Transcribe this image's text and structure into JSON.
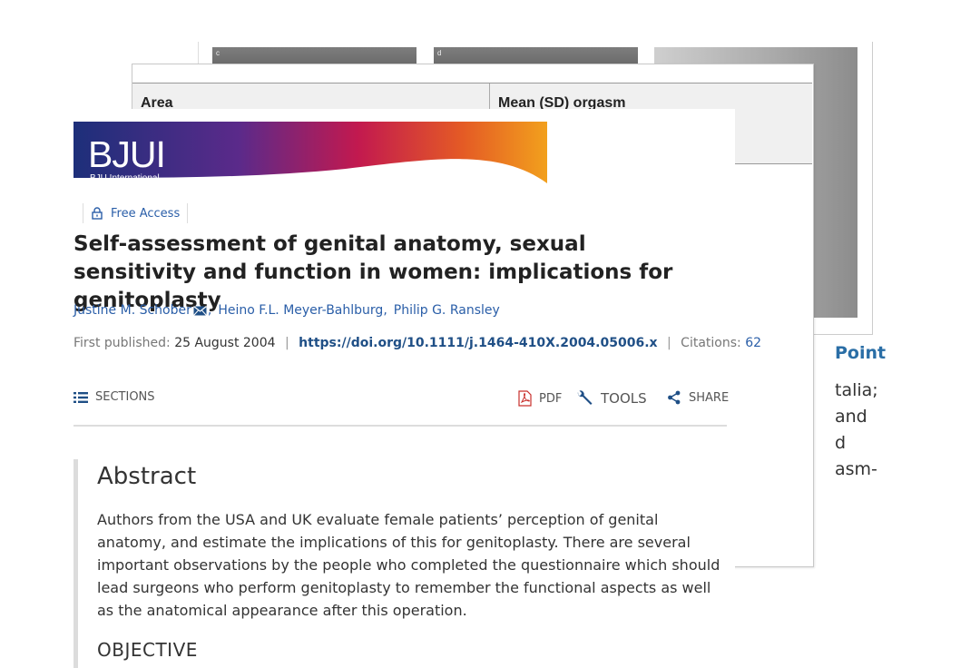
{
  "back": {
    "panel_labels": [
      "c",
      "d",
      "e"
    ],
    "text_lines": [
      "Point",
      "talia;",
      "and",
      "d",
      "asm-"
    ]
  },
  "table": {
    "col1_header": "Area",
    "col2_header": "Mean (SD) orgasm"
  },
  "journal": {
    "logo": "BJUI",
    "logo_sub": "BJU International"
  },
  "access": {
    "label": "Free Access",
    "icon": "lock-icon"
  },
  "article": {
    "title": "Self-assessment of genital anatomy, sexual sensitivity and function in women: implications for genitoplasty",
    "authors": [
      "Justine M. Schober",
      "Heino F.L. Meyer-Bahlburg",
      "Philip G. Ransley"
    ],
    "first_published_label": "First published:",
    "first_published_date": "25 August 2004",
    "doi": "https://doi.org/10.1111/j.1464-410X.2004.05006.x",
    "citations_label": "Citations:",
    "citations_count": "62"
  },
  "toolbar": {
    "sections": "SECTIONS",
    "pdf": "PDF",
    "tools": "TOOLS",
    "share": "SHARE"
  },
  "abstract": {
    "heading": "Abstract",
    "body": "Authors from the USA and UK evaluate female patients’ perception of genital anatomy, and estimate the implications of this for genitoplasty. There are several important observations by the people who completed the questionnaire which should lead surgeons who perform genitoplasty to remember the functional aspects as well as the anatomical appearance after this operation.",
    "next_heading": "OBJECTIVE"
  },
  "colors": {
    "link": "#2a5ea8",
    "doi": "#1f4f86",
    "banner_start": "#1d2f7a",
    "banner_end": "#f2a01d"
  }
}
